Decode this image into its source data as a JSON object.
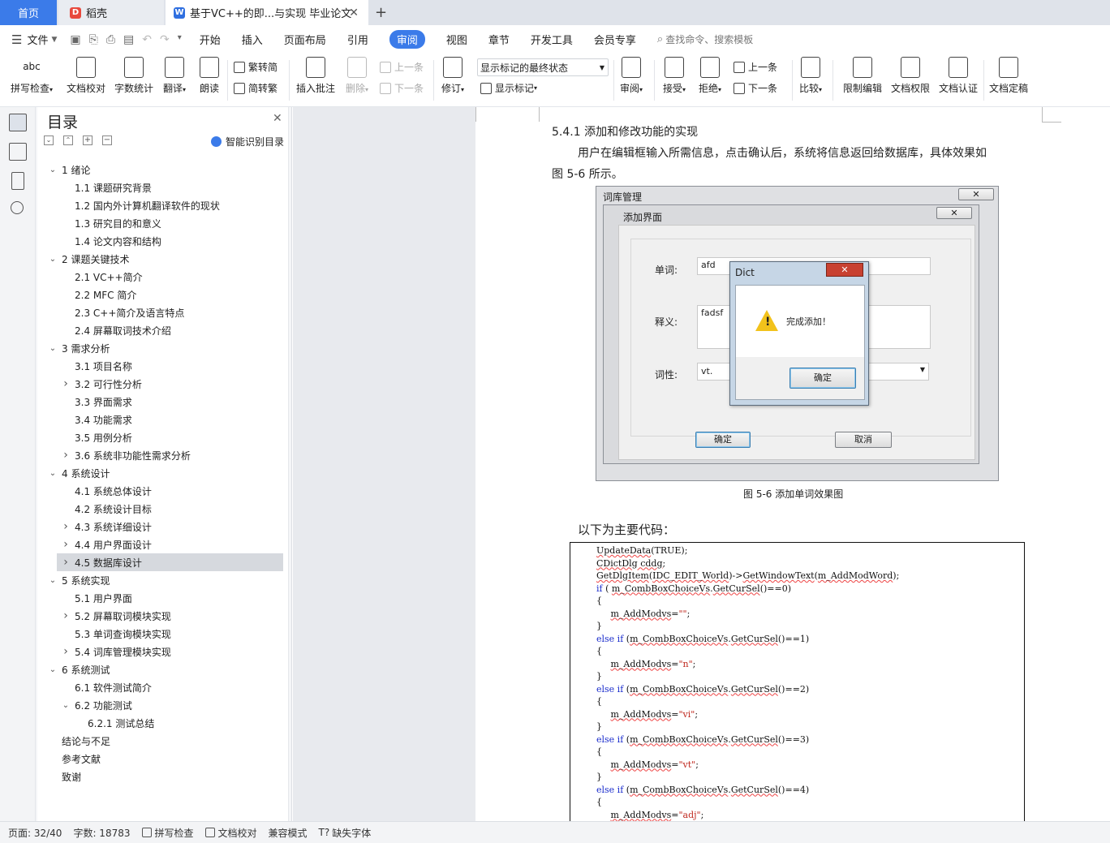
{
  "tabs": {
    "home": "首页",
    "docer": "稻壳",
    "doc": "基于VC++的即...与实现 毕业论文",
    "add": "+"
  },
  "menu": {
    "file": "文件",
    "items": [
      "开始",
      "插入",
      "页面布局",
      "引用",
      "审阅",
      "视图",
      "章节",
      "开发工具",
      "会员专享"
    ],
    "active": "审阅",
    "search": "查找命令、搜索模板"
  },
  "ribbon": {
    "spell": "拼写检查",
    "proof": "文档校对",
    "count": "字数统计",
    "translate": "翻译",
    "read": "朗读",
    "trad": "繁转简",
    "simp": "简转繁",
    "comment": "插入批注",
    "del": "删除",
    "prev_c": "上一条",
    "next_c": "下一条",
    "track": "修订",
    "markup_select": "显示标记的最终状态",
    "show_markup": "显示标记",
    "review": "审阅",
    "accept": "接受",
    "reject": "拒绝",
    "prev": "上一条",
    "next": "下一条",
    "compare": "比较",
    "restrict": "限制编辑",
    "perm": "文档权限",
    "auth": "文档认证",
    "final": "文档定稿"
  },
  "toc": {
    "title": "目录",
    "smart": "智能识别目录",
    "items": [
      {
        "t": "1  绪论",
        "l": 0,
        "car": "v"
      },
      {
        "t": "1.1  课题研究背景",
        "l": 1,
        "car": ""
      },
      {
        "t": "1.2  国内外计算机翻译软件的现状",
        "l": 1,
        "car": ""
      },
      {
        "t": "1.3  研究目的和意义",
        "l": 1,
        "car": ""
      },
      {
        "t": "1.4  论文内容和结构",
        "l": 1,
        "car": ""
      },
      {
        "t": "2  课题关键技术",
        "l": 0,
        "car": "v"
      },
      {
        "t": "2.1  VC++简介",
        "l": 1,
        "car": ""
      },
      {
        "t": "2.2  MFC 简介",
        "l": 1,
        "car": ""
      },
      {
        "t": "2.3  C++简介及语言特点",
        "l": 1,
        "car": ""
      },
      {
        "t": "2.4  屏幕取词技术介绍",
        "l": 1,
        "car": ""
      },
      {
        "t": "3  需求分析",
        "l": 0,
        "car": "v"
      },
      {
        "t": "3.1  项目名称",
        "l": 1,
        "car": ""
      },
      {
        "t": "3.2  可行性分析",
        "l": 1,
        "car": ">"
      },
      {
        "t": "3.3  界面需求",
        "l": 1,
        "car": ""
      },
      {
        "t": "3.4  功能需求",
        "l": 1,
        "car": ""
      },
      {
        "t": "3.5  用例分析",
        "l": 1,
        "car": ""
      },
      {
        "t": "3.6  系统非功能性需求分析",
        "l": 1,
        "car": ">"
      },
      {
        "t": "4  系统设计",
        "l": 0,
        "car": "v"
      },
      {
        "t": "4.1  系统总体设计",
        "l": 1,
        "car": ""
      },
      {
        "t": "4.2  系统设计目标",
        "l": 1,
        "car": ""
      },
      {
        "t": "4.3  系统详细设计",
        "l": 1,
        "car": ">"
      },
      {
        "t": "4.4  用户界面设计",
        "l": 1,
        "car": ">"
      },
      {
        "t": "4.5  数据库设计",
        "l": 1,
        "car": ">",
        "sel": true
      },
      {
        "t": "5  系统实现",
        "l": 0,
        "car": "v"
      },
      {
        "t": "5.1  用户界面",
        "l": 1,
        "car": ""
      },
      {
        "t": "5.2  屏幕取词模块实现",
        "l": 1,
        "car": ">"
      },
      {
        "t": "5.3  单词查询模块实现",
        "l": 1,
        "car": ""
      },
      {
        "t": "5.4  词库管理模块实现",
        "l": 1,
        "car": ">"
      },
      {
        "t": "6  系统测试",
        "l": 0,
        "car": "v"
      },
      {
        "t": "6.1  软件测试简介",
        "l": 1,
        "car": ""
      },
      {
        "t": "6.2  功能测试",
        "l": 1,
        "car": "v"
      },
      {
        "t": "6.2.1  测试总结",
        "l": 2,
        "car": ""
      },
      {
        "t": "结论与不足",
        "l": 0,
        "car": ""
      },
      {
        "t": "参考文献",
        "l": 0,
        "car": ""
      },
      {
        "t": "致谢",
        "l": 0,
        "car": ""
      }
    ]
  },
  "doc": {
    "heading": "5.4.1    添加和修改功能的实现",
    "para1": "用户在编辑框输入所需信息，点击确认后，系统将信息返回给数据库，具体效果如",
    "para2": "图 5-6 所示。",
    "fig": {
      "outer_title": "词库管理",
      "inner_title": "添加界面",
      "word_label": "单词:",
      "word_value": "afd",
      "def_label": "释义:",
      "def_value": "fadsf",
      "pos_label": "词性:",
      "pos_value": "vt.",
      "ok": "确定",
      "cancel": "取消",
      "msg_title": "Dict",
      "msg_text": "完成添加！",
      "msg_ok": "确定"
    },
    "caption": "图 5-6 添加单词效果图",
    "code_intro": "以下为主要代码："
  },
  "status": {
    "page": "页面: 32/40",
    "words": "字数: 18783",
    "spell": "拼写检查",
    "proof": "文档校对",
    "compat": "兼容模式",
    "font": "缺失字体"
  }
}
